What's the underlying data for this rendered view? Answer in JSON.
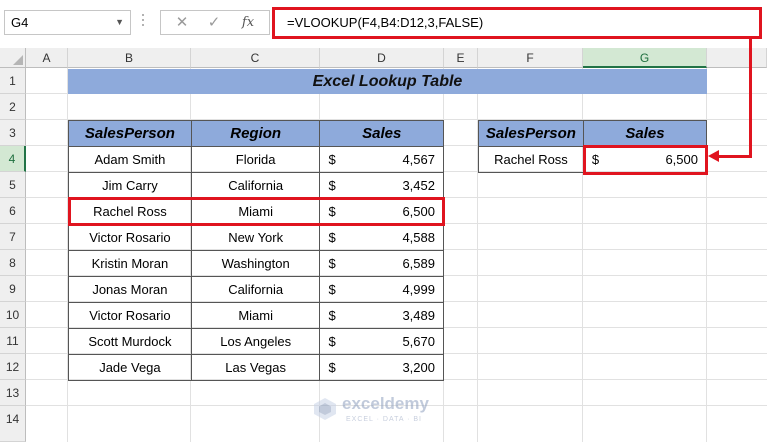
{
  "namebox": {
    "value": "G4"
  },
  "formula_bar": {
    "cancel": "✕",
    "enter": "✓",
    "fx": "fx",
    "formula": "=VLOOKUP(F4,B4:D12,3,FALSE)"
  },
  "columns": [
    "A",
    "B",
    "C",
    "D",
    "E",
    "F",
    "G"
  ],
  "rows": [
    "1",
    "2",
    "3",
    "4",
    "5",
    "6",
    "7",
    "8",
    "9",
    "10",
    "11",
    "12",
    "13",
    "14"
  ],
  "title": "Excel Lookup Table",
  "main_table": {
    "headers": [
      "SalesPerson",
      "Region",
      "Sales"
    ],
    "rows": [
      {
        "person": "Adam Smith",
        "region": "Florida",
        "currency": "$",
        "sales": "4,567"
      },
      {
        "person": "Jim Carry",
        "region": "California",
        "currency": "$",
        "sales": "3,452"
      },
      {
        "person": "Rachel Ross",
        "region": "Miami",
        "currency": "$",
        "sales": "6,500"
      },
      {
        "person": "Victor Rosario",
        "region": "New York",
        "currency": "$",
        "sales": "4,588"
      },
      {
        "person": "Kristin Moran",
        "region": "Washington",
        "currency": "$",
        "sales": "6,589"
      },
      {
        "person": "Jonas Moran",
        "region": "California",
        "currency": "$",
        "sales": "4,999"
      },
      {
        "person": "Victor Rosario",
        "region": "Miami",
        "currency": "$",
        "sales": "3,489"
      },
      {
        "person": "Scott Murdock",
        "region": "Los Angeles",
        "currency": "$",
        "sales": "5,670"
      },
      {
        "person": "Jade Vega",
        "region": "Las Vegas",
        "currency": "$",
        "sales": "3,200"
      }
    ]
  },
  "lookup_table": {
    "headers": [
      "SalesPerson",
      "Sales"
    ],
    "person": "Rachel Ross",
    "currency": "$",
    "sales": "6,500"
  },
  "watermark": {
    "name": "exceldemy",
    "tagline": "EXCEL · DATA · BI"
  },
  "colors": {
    "header_fill": "#8eaadb",
    "highlight": "#e0141f",
    "selection": "#217346"
  }
}
